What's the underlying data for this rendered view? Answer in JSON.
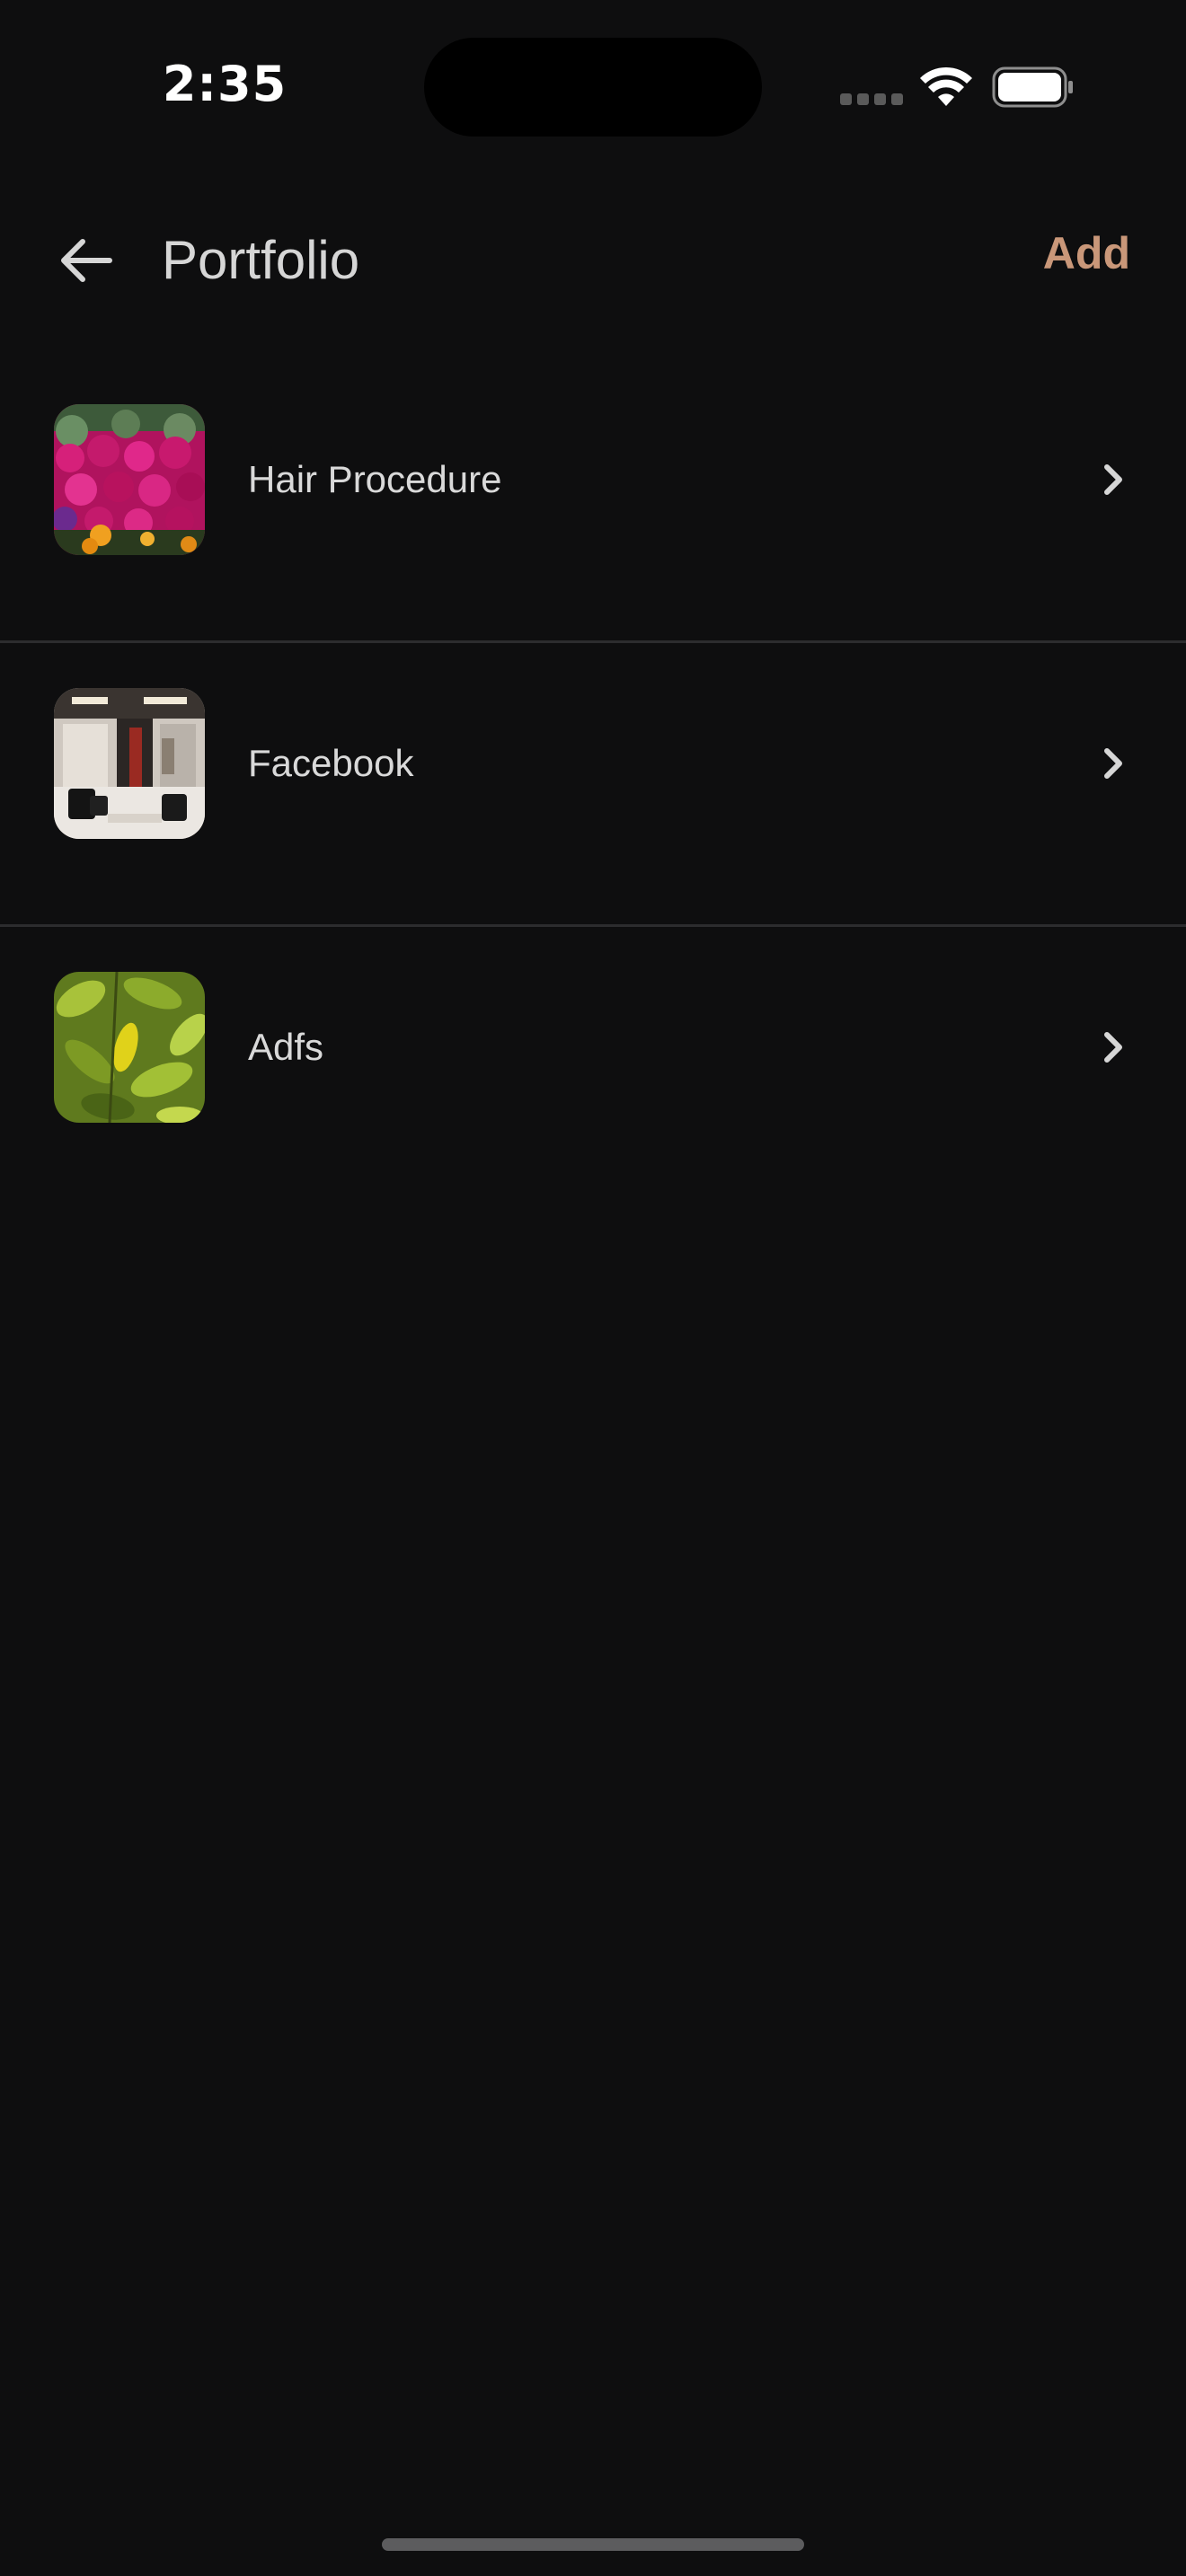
{
  "status_bar": {
    "time": "2:35"
  },
  "header": {
    "title": "Portfolio",
    "add_label": "Add",
    "back_icon": "arrow-left-icon"
  },
  "colors": {
    "background": "#0e0e0f",
    "accent": "#c99779",
    "divider": "#2c2c2e",
    "text": "#d9d9d9"
  },
  "portfolio_items": [
    {
      "label": "Hair Procedure",
      "thumbnail": "pink-flowers-image"
    },
    {
      "label": "Facebook",
      "thumbnail": "salon-interior-image"
    },
    {
      "label": "Adfs",
      "thumbnail": "green-leaves-image"
    }
  ]
}
